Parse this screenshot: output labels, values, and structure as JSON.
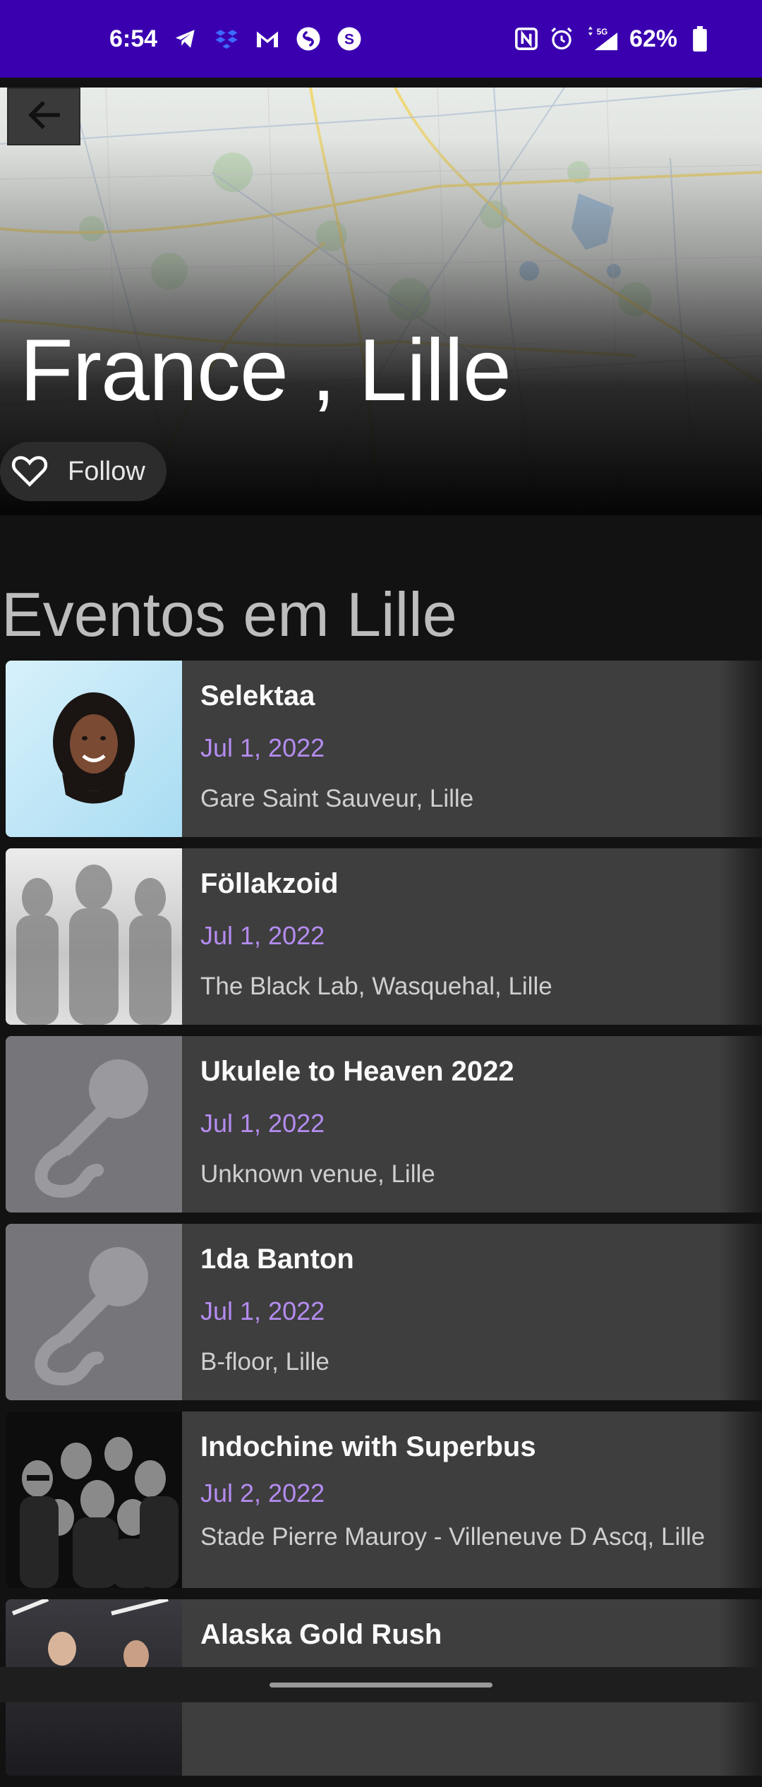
{
  "status_bar": {
    "time": "6:54",
    "battery": "62%",
    "left_icons": [
      "telegram-icon",
      "dropbox-icon",
      "gmail-icon",
      "shazam-icon",
      "skrill-icon"
    ],
    "right_icons": [
      "nfc-icon",
      "alarm-icon",
      "signal-5g-icon",
      "battery-icon"
    ],
    "network": "5G"
  },
  "header": {
    "city_title": "France , Lille",
    "follow_label": "Follow"
  },
  "section": {
    "title": "Eventos em Lille"
  },
  "events": [
    {
      "name": "Selektaa",
      "date": "Jul 1, 2022",
      "venue": "Gare Saint Sauveur, Lille",
      "image": "artist-photo"
    },
    {
      "name": "Föllakzoid",
      "date": "Jul 1, 2022",
      "venue": "The Black Lab, Wasquehal, Lille",
      "image": "band-photo"
    },
    {
      "name": "Ukulele to Heaven 2022",
      "date": "Jul 1, 2022",
      "venue": "Unknown venue, Lille",
      "image": "microphone-icon"
    },
    {
      "name": "1da Banton",
      "date": "Jul 1, 2022",
      "venue": "B-floor, Lille",
      "image": "microphone-icon"
    },
    {
      "name": "Indochine with Superbus",
      "date": "Jul 2, 2022",
      "venue": "Stade Pierre Mauroy - Villeneuve D Ascq, Lille",
      "image": "band-photo"
    },
    {
      "name": "Alaska Gold Rush",
      "date": "",
      "venue": "",
      "image": "band-photo"
    }
  ],
  "colors": {
    "status_bar": "#3a00b0",
    "date_accent": "#b48cf0",
    "card_bg": "#3e3e3e",
    "background": "#121212"
  }
}
